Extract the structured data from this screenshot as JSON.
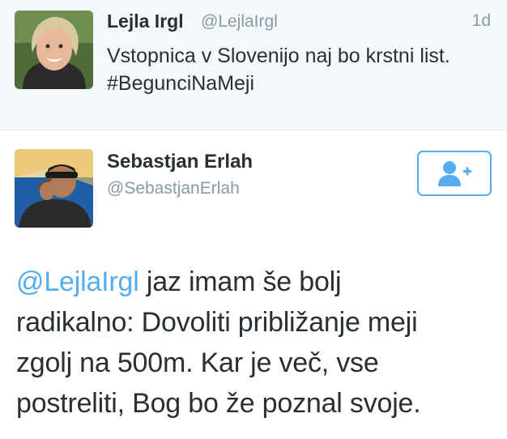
{
  "parent_tweet": {
    "display_name": "Lejla Irgl",
    "handle": "@LejlaIrgl",
    "timestamp": "1d",
    "text_lines": [
      "Vstopnica v Slovenijo naj bo krstni list.",
      "#BegunciNaMeji"
    ],
    "avatar": "woman-smiling-avatar"
  },
  "reply_tweet": {
    "display_name": "Sebastjan Erlah",
    "handle": "@SebastjanErlah",
    "avatar": "man-with-cigar-avatar",
    "follow_button": {
      "icon": "add-user-icon",
      "color": "#55acee"
    },
    "mention": "@LejlaIrgl",
    "text_lines": [
      " jaz imam še bolj",
      "radikalno: Dovoliti približanje meji",
      "zgolj na 500m. Kar je več, vse",
      "postreliti, Bog bo že poznal svoje."
    ]
  },
  "colors": {
    "accent": "#55acee",
    "secondary_text": "#8899a6",
    "primary_text": "#292f33",
    "parent_background": "#f5f8fa"
  }
}
